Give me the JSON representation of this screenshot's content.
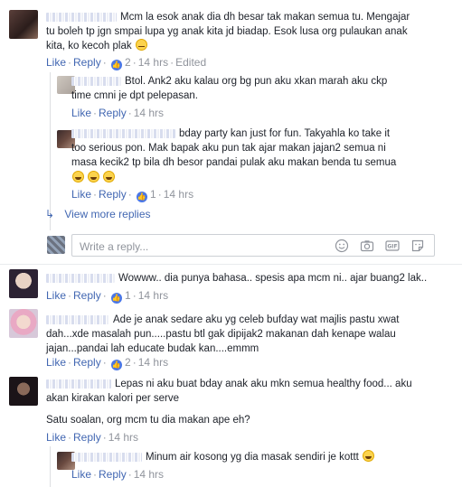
{
  "actions": {
    "like": "Like",
    "reply": "Reply",
    "edited": "Edited"
  },
  "comments": [
    {
      "lines": [
        "Mcm la esok anak dia dh besar tak makan semua tu. Mengajar",
        "tu boleh tp jgn smpai lupa yg anak kita jd biadap. Esok lusa org pulaukan anak",
        "kita, ko kecoh plak"
      ],
      "likes": "2",
      "time": "14 hrs"
    },
    {
      "lines": [
        "Btol. Ank2 aku kalau org bg pun aku xkan marah aku ckp",
        "time cmni je dpt pelepasan."
      ],
      "time": "14 hrs"
    },
    {
      "lines": [
        "bday party kan just for fun. Takyahla ko take it",
        "too serious pon. Mak bapak aku pun tak ajar makan jajan2 semua ni",
        "masa kecik2 tp bila dh besor pandai pulak aku makan benda tu semua"
      ],
      "likes": "1",
      "time": "14 hrs"
    },
    {
      "lines": [
        "Wowww.. dia punya bahasa.. spesis apa mcm ni.. ajar buang2 lak.."
      ],
      "likes": "1",
      "time": "14 hrs"
    },
    {
      "lines": [
        "Ade je anak sedare aku yg celeb bufday wat majlis pastu xwat",
        "dah...xde masalah pun.....pastu btl gak dipijak2 makanan dah kenape walau",
        "jajan...pandai lah educate budak kan....emmm"
      ],
      "likes": "2",
      "time": "14 hrs"
    },
    {
      "lines": [
        "Lepas ni aku buat bday anak aku mkn semua healthy food... aku",
        "akan kirakan kalori per serve"
      ],
      "lines2": [
        "Satu soalan, org mcm tu dia makan ape eh?"
      ],
      "time": "14 hrs"
    },
    {
      "lines": [
        "Minum air kosong yg dia masak sendiri je kottt"
      ],
      "time": "14 hrs"
    }
  ],
  "view_more": "View more replies",
  "reply_box": {
    "placeholder": "Write a reply..."
  },
  "colors": {
    "link": "#4267b2",
    "meta": "#90949c",
    "like_badge": "#4a77e7"
  },
  "icons": [
    "thumbs-up-icon",
    "reply-arrow-icon",
    "smiley-icon",
    "camera-icon",
    "gif-icon",
    "sticker-icon"
  ]
}
